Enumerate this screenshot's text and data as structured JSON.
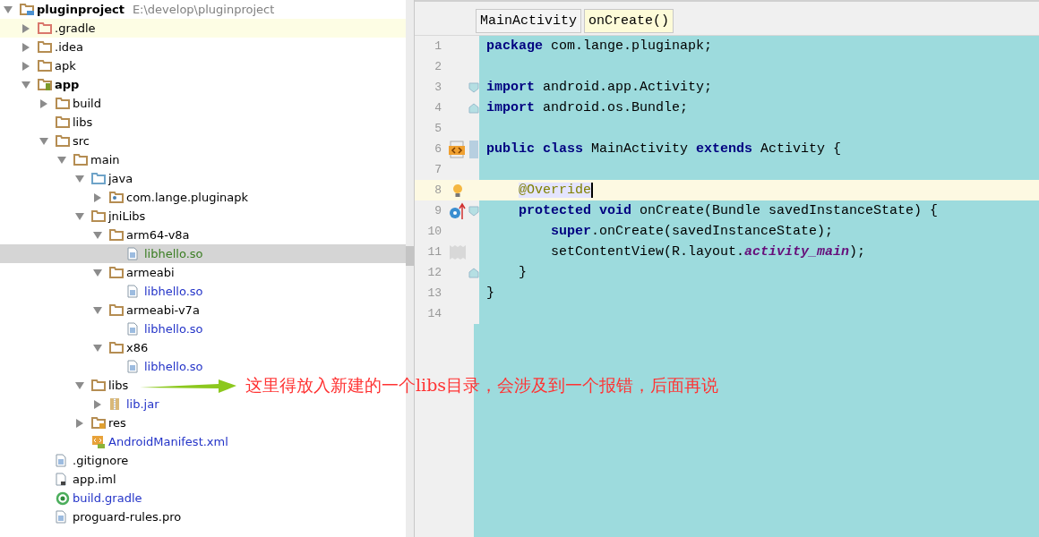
{
  "project_tree": {
    "root": {
      "label": "pluginproject",
      "path": "E:\\develop\\pluginproject",
      "kind": "project",
      "expanded": true,
      "selected": false,
      "highlighted": false,
      "color": "#000000",
      "children": [
        {
          "label": ".gradle",
          "kind": "excluded",
          "expanded": false,
          "selected": false,
          "highlighted": true,
          "color": "#000000"
        },
        {
          "label": ".idea",
          "kind": "folder",
          "expanded": false,
          "selected": false,
          "highlighted": false,
          "color": "#000000"
        },
        {
          "label": "apk",
          "kind": "folder",
          "expanded": false,
          "selected": false,
          "highlighted": false,
          "color": "#000000"
        },
        {
          "label": "app",
          "kind": "module",
          "expanded": true,
          "selected": false,
          "highlighted": false,
          "color": "#000000",
          "children": [
            {
              "label": "build",
              "kind": "folder",
              "expanded": false,
              "selected": false,
              "highlighted": false,
              "color": "#000000"
            },
            {
              "label": "libs",
              "kind": "folder",
              "selected": false,
              "highlighted": false,
              "color": "#000000"
            },
            {
              "label": "src",
              "kind": "folder",
              "expanded": true,
              "selected": false,
              "highlighted": false,
              "color": "#000000",
              "children": [
                {
                  "label": "main",
                  "kind": "folder",
                  "expanded": true,
                  "selected": false,
                  "highlighted": false,
                  "color": "#000000",
                  "children": [
                    {
                      "label": "java",
                      "kind": "source",
                      "expanded": true,
                      "selected": false,
                      "highlighted": false,
                      "color": "#000000",
                      "children": [
                        {
                          "label": "com.lange.pluginapk",
                          "kind": "package",
                          "expanded": false,
                          "selected": false,
                          "highlighted": false,
                          "color": "#000000"
                        }
                      ]
                    },
                    {
                      "label": "jniLibs",
                      "kind": "folder",
                      "expanded": true,
                      "selected": false,
                      "highlighted": false,
                      "color": "#000000",
                      "children": [
                        {
                          "label": "arm64-v8a",
                          "kind": "folder",
                          "expanded": true,
                          "selected": false,
                          "highlighted": false,
                          "color": "#000000",
                          "children": [
                            {
                              "label": "libhello.so",
                              "kind": "file",
                              "selected": true,
                              "highlighted": false,
                              "color": "#3a7d22"
                            }
                          ]
                        },
                        {
                          "label": "armeabi",
                          "kind": "folder",
                          "expanded": true,
                          "selected": false,
                          "highlighted": false,
                          "color": "#000000",
                          "children": [
                            {
                              "label": "libhello.so",
                              "kind": "file",
                              "selected": false,
                              "highlighted": false,
                              "color": "#2434c8"
                            }
                          ]
                        },
                        {
                          "label": "armeabi-v7a",
                          "kind": "folder",
                          "expanded": true,
                          "selected": false,
                          "highlighted": false,
                          "color": "#000000",
                          "children": [
                            {
                              "label": "libhello.so",
                              "kind": "file",
                              "selected": false,
                              "highlighted": false,
                              "color": "#2434c8"
                            }
                          ]
                        },
                        {
                          "label": "x86",
                          "kind": "folder",
                          "expanded": true,
                          "selected": false,
                          "highlighted": false,
                          "color": "#000000",
                          "children": [
                            {
                              "label": "libhello.so",
                              "kind": "file",
                              "selected": false,
                              "highlighted": false,
                              "color": "#2434c8"
                            }
                          ]
                        }
                      ]
                    },
                    {
                      "label": "libs",
                      "kind": "folder",
                      "expanded": true,
                      "selected": false,
                      "highlighted": false,
                      "color": "#000000",
                      "children": [
                        {
                          "label": "lib.jar",
                          "kind": "jar",
                          "expanded": false,
                          "selected": false,
                          "highlighted": false,
                          "color": "#2434c8"
                        }
                      ]
                    },
                    {
                      "label": "res",
                      "kind": "res",
                      "expanded": false,
                      "selected": false,
                      "highlighted": false,
                      "color": "#000000"
                    },
                    {
                      "label": "AndroidManifest.xml",
                      "kind": "manifest",
                      "selected": false,
                      "highlighted": false,
                      "color": "#2434c8"
                    }
                  ]
                }
              ]
            },
            {
              "label": ".gitignore",
              "kind": "file",
              "selected": false,
              "highlighted": false,
              "color": "#000000"
            },
            {
              "label": "app.iml",
              "kind": "iml",
              "selected": false,
              "highlighted": false,
              "color": "#000000"
            },
            {
              "label": "build.gradle",
              "kind": "gradle",
              "selected": false,
              "highlighted": false,
              "color": "#2434c8"
            },
            {
              "label": "proguard-rules.pro",
              "kind": "file",
              "selected": false,
              "highlighted": false,
              "color": "#000000"
            }
          ]
        }
      ]
    }
  },
  "breadcrumbs": [
    {
      "label": "MainActivity",
      "selected": false
    },
    {
      "label": "onCreate()",
      "selected": true
    }
  ],
  "editor": {
    "lines": [
      {
        "number": "1",
        "current": false,
        "tokens": [
          {
            "text": "package",
            "kind": "keyword"
          },
          {
            "text": " com.lange.pluginapk;",
            "kind": "plain"
          }
        ]
      },
      {
        "number": "2",
        "current": false
      },
      {
        "number": "3",
        "current": false,
        "fold_marker": {
          "kind": "start"
        },
        "tokens": [
          {
            "text": "import",
            "kind": "keyword"
          },
          {
            "text": " android.app.Activity;",
            "kind": "plain"
          }
        ]
      },
      {
        "number": "4",
        "current": false,
        "fold_marker": {
          "kind": "end"
        },
        "tokens": [
          {
            "text": "import",
            "kind": "keyword"
          },
          {
            "text": " android.os.Bundle;",
            "kind": "plain"
          }
        ]
      },
      {
        "number": "5",
        "current": false
      },
      {
        "number": "6",
        "current": false,
        "gutter_icon": {
          "kind": "class"
        },
        "fold_marker": {
          "kind": "mark"
        },
        "tokens": [
          {
            "text": "public class",
            "kind": "keyword"
          },
          {
            "text": " MainActivity ",
            "kind": "plain"
          },
          {
            "text": "extends",
            "kind": "keyword"
          },
          {
            "text": " Activity {",
            "kind": "plain"
          }
        ]
      },
      {
        "number": "7",
        "current": false
      },
      {
        "number": "8",
        "current": true,
        "gutter_icon": {
          "kind": "bulb"
        },
        "tokens": [
          {
            "text": "    @Override",
            "kind": "annotation"
          }
        ]
      },
      {
        "number": "9",
        "current": false,
        "gutter_icon": {
          "kind": "override"
        },
        "fold_marker": {
          "kind": "start"
        },
        "tokens": [
          {
            "text": "    protected void",
            "kind": "keyword"
          },
          {
            "text": " onCreate(Bundle savedInstanceState) {",
            "kind": "plain"
          }
        ]
      },
      {
        "number": "10",
        "current": false,
        "tokens": [
          {
            "text": "        super",
            "kind": "keyword"
          },
          {
            "text": ".onCreate(savedInstanceState);",
            "kind": "plain"
          }
        ]
      },
      {
        "number": "11",
        "current": false,
        "gutter_icon": {
          "kind": "layout"
        },
        "tokens": [
          {
            "text": "        setContentView(R.layout.",
            "kind": "plain"
          },
          {
            "text": "activity_main",
            "kind": "field"
          },
          {
            "text": ");",
            "kind": "plain"
          }
        ]
      },
      {
        "number": "12",
        "current": false,
        "fold_marker": {
          "kind": "end"
        },
        "tokens": [
          {
            "text": "    }",
            "kind": "plain"
          }
        ]
      },
      {
        "number": "13",
        "current": false,
        "tokens": [
          {
            "text": "}",
            "kind": "plain"
          }
        ]
      },
      {
        "number": "14",
        "current": false
      }
    ]
  },
  "annotation": {
    "text": "这里得放入新建的一个libs目录，会涉及到一个报错，后面再说"
  }
}
